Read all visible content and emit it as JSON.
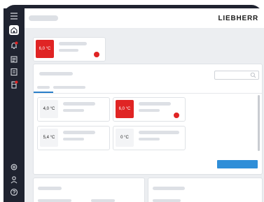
{
  "app": {
    "brand": "LIEBHERR"
  },
  "colors": {
    "alarm": "#e02424",
    "accent": "#2a7fc9",
    "sidebar": "#1f2330"
  },
  "sidebar": {
    "items": [
      {
        "icon": "menu-icon"
      },
      {
        "icon": "home-icon",
        "active": true
      },
      {
        "icon": "bell-icon",
        "badge": true
      },
      {
        "icon": "list-icon"
      },
      {
        "icon": "document-icon"
      },
      {
        "icon": "device-icon",
        "badge": true
      },
      {
        "icon": "settings-icon"
      },
      {
        "icon": "user-icon"
      },
      {
        "icon": "help-icon"
      }
    ]
  },
  "featured": {
    "temp": "6,0 °C",
    "alarm": true
  },
  "devices": [
    {
      "temp": "4,0 °C",
      "alarm": false
    },
    {
      "temp": "6,0 °C",
      "alarm": true
    },
    {
      "temp": "5,4 °C",
      "alarm": false
    },
    {
      "temp": "0 °C",
      "alarm": false
    }
  ]
}
